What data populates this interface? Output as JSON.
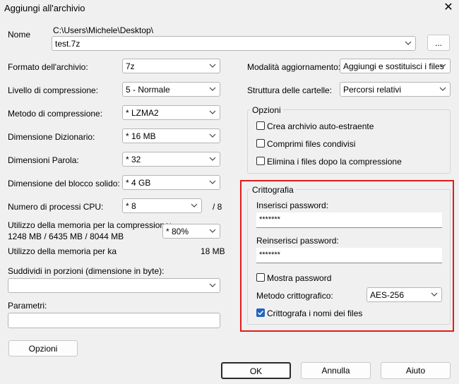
{
  "window": {
    "title": "Aggiungi all'archivio"
  },
  "name": {
    "label": "Nome",
    "path": "C:\\Users\\Michele\\Desktop\\",
    "value": "test.7z",
    "browse_label": "..."
  },
  "left": {
    "format": {
      "label": "Formato dell'archivio:",
      "value": "7z"
    },
    "level": {
      "label": "Livello di compressione:",
      "value": "5 - Normale"
    },
    "method": {
      "label": "Metodo di compressione:",
      "value": "* LZMA2"
    },
    "dict": {
      "label": "Dimensione Dizionario:",
      "value": "* 16 MB"
    },
    "word": {
      "label": "Dimensioni Parola:",
      "value": "* 32"
    },
    "solid": {
      "label": "Dimensione del blocco solido:",
      "value": "* 4 GB"
    },
    "threads": {
      "label": "Numero di processi CPU:",
      "value": "* 8",
      "max": "/ 8"
    },
    "memory": {
      "label_line1": "Utilizzo della memoria per la compressione:",
      "label_line2": "1248 MB / 6435 MB / 8044 MB",
      "value": "* 80%"
    },
    "memory_decomp": {
      "label": "Utilizzo della memoria per ka",
      "value": "18 MB"
    },
    "split": {
      "label": "Suddividi in porzioni (dimensione in byte):",
      "value": ""
    },
    "params": {
      "label": "Parametri:",
      "value": ""
    },
    "options_button": "Opzioni"
  },
  "right": {
    "update_mode": {
      "label": "Modalità aggiornamento:",
      "value": "Aggiungi e sostituisci i files"
    },
    "path_mode": {
      "label": "Struttura delle cartelle:",
      "value": "Percorsi relativi"
    },
    "options": {
      "title": "Opzioni",
      "sfx": {
        "label": "Crea archivio auto-estraente",
        "checked": false
      },
      "shared": {
        "label": "Comprimi files condivisi",
        "checked": false
      },
      "delete": {
        "label": "Elimina i files dopo la compressione",
        "checked": false
      }
    },
    "encryption": {
      "title": "Crittografia",
      "password_label": "Inserisci password:",
      "password_value": "*******",
      "reenter_label": "Reinserisci password:",
      "reenter_value": "*******",
      "show_password": {
        "label": "Mostra password",
        "checked": false
      },
      "method_label": "Metodo crittografico:",
      "method_value": "AES-256",
      "encrypt_names": {
        "label": "Crittografa i nomi dei files",
        "checked": true
      },
      "highlight_color": "#e21b1b"
    }
  },
  "buttons": {
    "ok": "OK",
    "cancel": "Annulla",
    "help": "Aiuto"
  },
  "colors": {
    "accent": "#2563bd",
    "background": "#f0f0f0"
  }
}
